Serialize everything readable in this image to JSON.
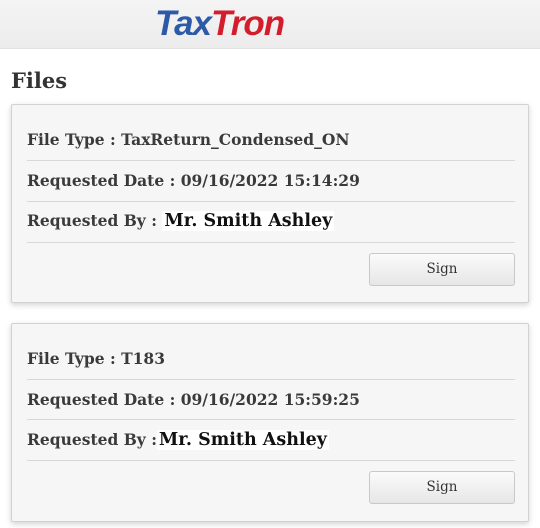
{
  "header": {
    "logo_part1": "Tax",
    "logo_part2": "Tron",
    "logo_colors": {
      "tax": "#2d5aa6",
      "tron": "#d31c2c"
    }
  },
  "page": {
    "title": "Files"
  },
  "files": [
    {
      "file_type_label": "File Type : ",
      "file_type": "TaxReturn_Condensed_ON",
      "requested_date_label": "Requested Date : ",
      "requested_date": "09/16/2022 15:14:29",
      "requested_by_label": "Requested By : ",
      "requested_by": "Mr. Smith Ashley",
      "sign_label": "Sign"
    },
    {
      "file_type_label": "File Type : ",
      "file_type": "T183",
      "requested_date_label": "Requested Date : ",
      "requested_date": "09/16/2022 15:59:25",
      "requested_by_label": "Requested By :",
      "requested_by": "Mr. Smith Ashley",
      "sign_label": "Sign"
    }
  ]
}
